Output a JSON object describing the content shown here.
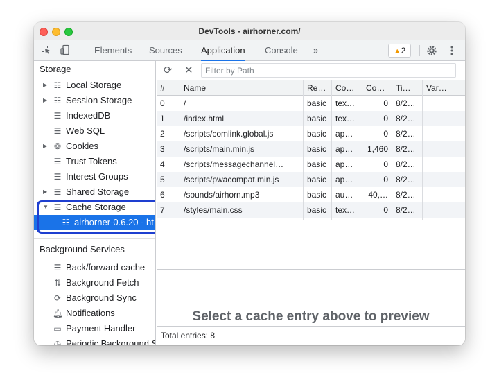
{
  "window": {
    "title": "DevTools - airhorner.com/"
  },
  "toolbar": {
    "tabs": [
      "Elements",
      "Sources",
      "Application",
      "Console"
    ],
    "more": "»",
    "warnings_count": "2"
  },
  "sidebar": {
    "storage_title": "Storage",
    "storage_items": [
      {
        "label": "Local Storage"
      },
      {
        "label": "Session Storage"
      },
      {
        "label": "IndexedDB"
      },
      {
        "label": "Web SQL"
      },
      {
        "label": "Cookies"
      },
      {
        "label": "Trust Tokens"
      },
      {
        "label": "Interest Groups"
      },
      {
        "label": "Shared Storage"
      },
      {
        "label": "Cache Storage"
      },
      {
        "label": "airhorner-0.6.20 - ht"
      }
    ],
    "bg_title": "Background Services",
    "bg_items": [
      {
        "label": "Back/forward cache"
      },
      {
        "label": "Background Fetch"
      },
      {
        "label": "Background Sync"
      },
      {
        "label": "Notifications"
      },
      {
        "label": "Payment Handler"
      },
      {
        "label": "Periodic Background S"
      }
    ]
  },
  "filter": {
    "placeholder": "Filter by Path"
  },
  "table": {
    "headers": [
      "#",
      "Name",
      "Re…",
      "Co…",
      "Co…",
      "Ti…",
      "Var…"
    ],
    "rows": [
      [
        "0",
        "/",
        "basic",
        "tex…",
        "0",
        "8/2…",
        ""
      ],
      [
        "1",
        "/index.html",
        "basic",
        "tex…",
        "0",
        "8/2…",
        ""
      ],
      [
        "2",
        "/scripts/comlink.global.js",
        "basic",
        "ap…",
        "0",
        "8/2…",
        ""
      ],
      [
        "3",
        "/scripts/main.min.js",
        "basic",
        "ap…",
        "1,460",
        "8/2…",
        ""
      ],
      [
        "4",
        "/scripts/messagechannel…",
        "basic",
        "ap…",
        "0",
        "8/2…",
        ""
      ],
      [
        "5",
        "/scripts/pwacompat.min.js",
        "basic",
        "ap…",
        "0",
        "8/2…",
        ""
      ],
      [
        "6",
        "/sounds/airhorn.mp3",
        "basic",
        "au…",
        "40,…",
        "8/2…",
        ""
      ],
      [
        "7",
        "/styles/main.css",
        "basic",
        "tex…",
        "0",
        "8/2…",
        ""
      ]
    ]
  },
  "preview": {
    "message": "Select a cache entry above to preview"
  },
  "status": {
    "total": "Total entries: 8"
  },
  "colors": {
    "accent": "#1a73e8",
    "highlight_box": "#1e3fd0"
  }
}
